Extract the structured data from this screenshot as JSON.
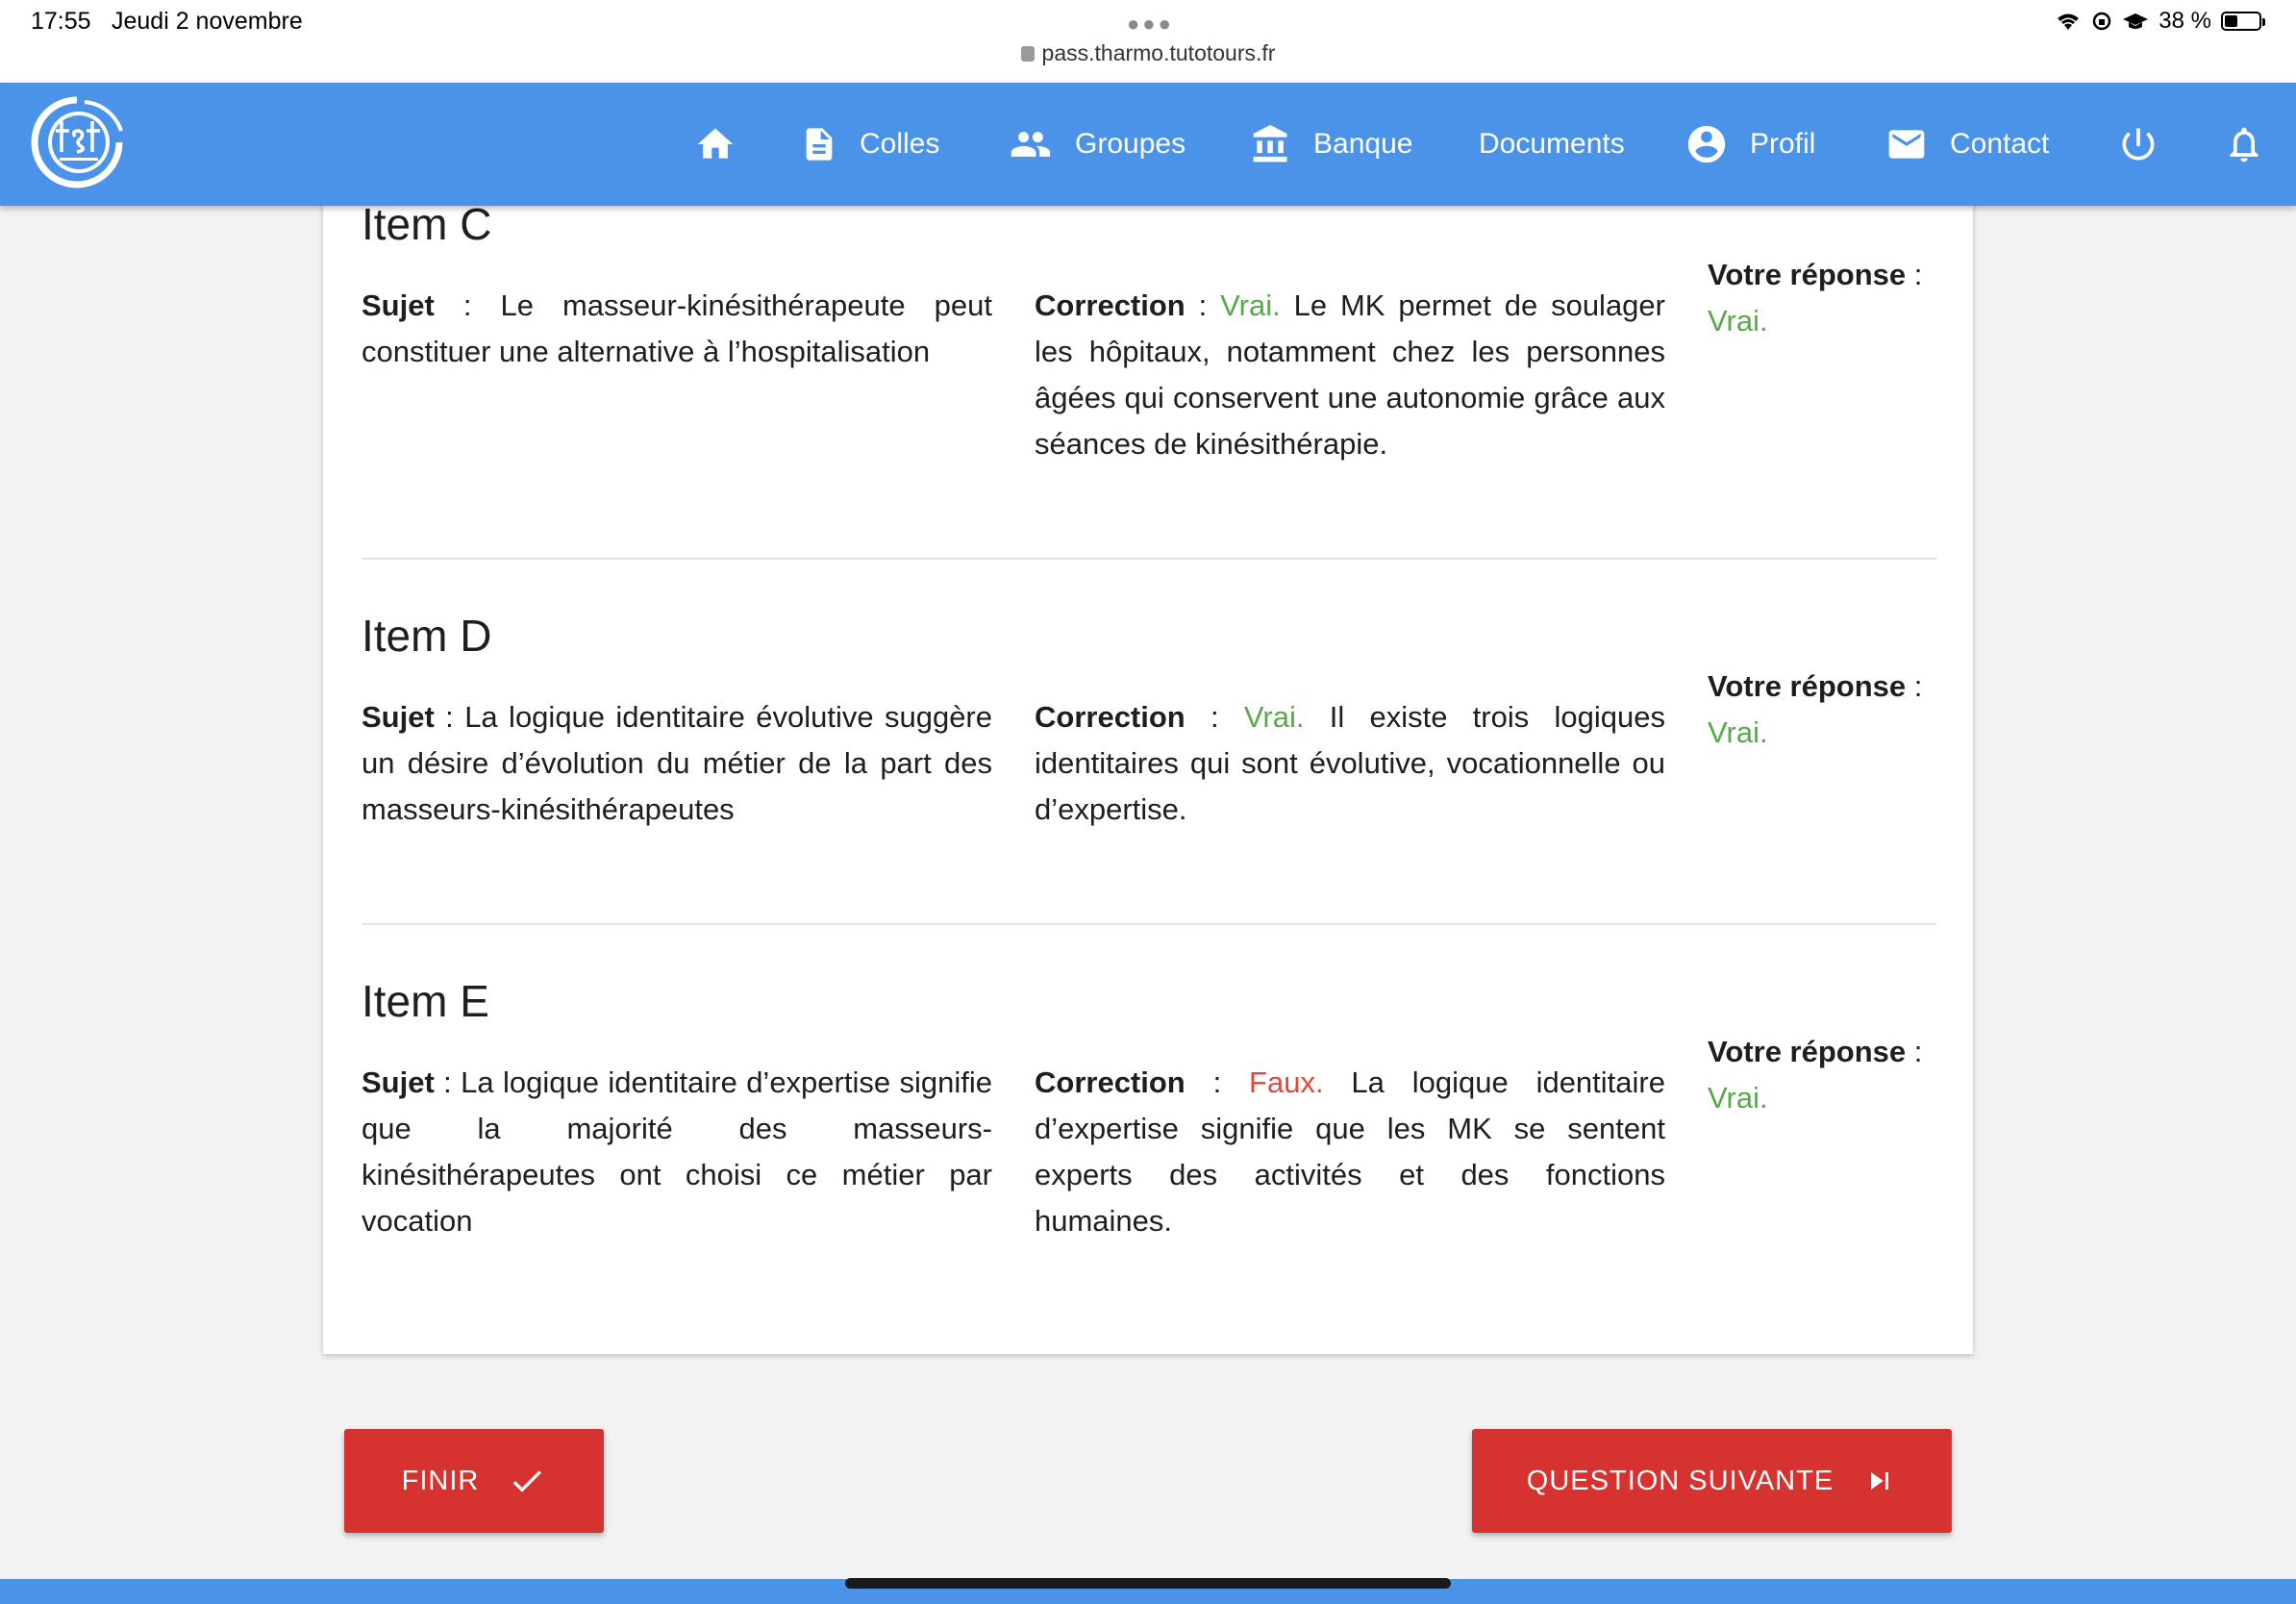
{
  "status_bar": {
    "time": "17:55",
    "date": "Jeudi 2 novembre",
    "url": "pass.tharmo.tutotours.fr",
    "battery": "38 %",
    "battery_level": 0.38
  },
  "nav": {
    "logo_text": "tst",
    "items": [
      {
        "label": "",
        "icon": "home-icon"
      },
      {
        "label": "Colles",
        "icon": "document-icon"
      },
      {
        "label": "Groupes",
        "icon": "group-icon"
      },
      {
        "label": "Banque",
        "icon": "bank-icon"
      },
      {
        "label": "Documents",
        "icon": ""
      },
      {
        "label": "Profil",
        "icon": "account-icon"
      },
      {
        "label": "Contact",
        "icon": "mail-icon"
      },
      {
        "label": "",
        "icon": "power-icon"
      },
      {
        "label": "",
        "icon": "bell-icon"
      }
    ]
  },
  "labels": {
    "subject": "Sujet",
    "correction": "Correction",
    "your_answer": "Votre réponse"
  },
  "items": [
    {
      "title": "Item C",
      "subject": "Le masseur-kinésithérapeute peut constituer une alternative à l’hospitalisation",
      "verdict": "Vrai.",
      "verdict_correct": true,
      "correction": "Le MK permet de soulager les hôpitaux, notamment chez les personnes âgées qui conservent une autonomie grâce aux séances de kinésithérapie.",
      "answer": "Vrai."
    },
    {
      "title": "Item D",
      "subject": "La logique identitaire évolutive suggère un désire d’évolution du métier de la part des masseurs-kinésithérapeutes",
      "verdict": "Vrai.",
      "verdict_correct": true,
      "correction": "Il existe trois logiques identitaires qui sont évolutive, vocationnelle ou d’expertise.",
      "answer": "Vrai."
    },
    {
      "title": "Item E",
      "subject": "La logique identitaire d’expertise signifie que la majorité des masseurs-kinésithérapeutes ont choisi ce métier par vocation",
      "verdict": "Faux.",
      "verdict_correct": false,
      "correction": "La logique identitaire d’expertise signifie que les MK se sentent experts des activités et des fonctions humaines.",
      "answer": "Vrai."
    }
  ],
  "buttons": {
    "finish": "FINIR",
    "next": "QUESTION SUIVANTE"
  },
  "colors": {
    "nav_blue": "#4a93e8",
    "button_red": "#d6322f",
    "correct_green": "#5aa84c",
    "wrong_red": "#e0483b"
  }
}
